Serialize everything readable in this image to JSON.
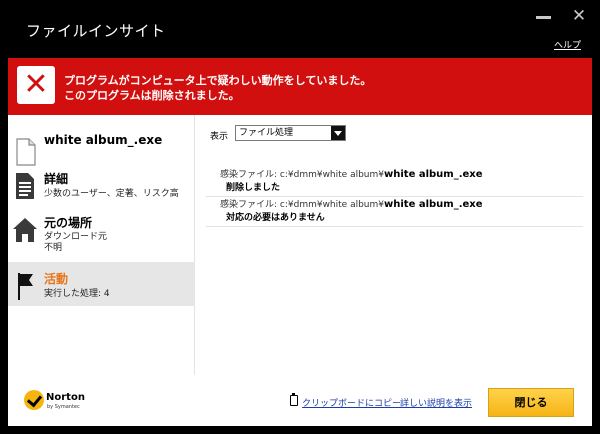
{
  "window": {
    "title": "ファイルインサイト",
    "help_label": "ヘルプ"
  },
  "alert": {
    "line1": "プログラムがコンピュータ上で疑わしい動作をしていました。",
    "line2": "このプログラムは削除されました。"
  },
  "sidebar": {
    "file_name": "white album_.exe",
    "details": {
      "title": "詳細",
      "subtitle": "少数のユーザー、定著、リスク高"
    },
    "origin": {
      "title": "元の場所",
      "sub1": "ダウンロード元",
      "sub2": "不明"
    },
    "activity": {
      "title": "活動",
      "subtitle": "実行した処理: 4"
    }
  },
  "panel": {
    "view_label": "表示",
    "view_selected": "ファイル処理",
    "rows": [
      {
        "prefix": "感染ファイル: c:¥dmm¥white album¥",
        "file": "white album_.exe",
        "status": "削除しました"
      },
      {
        "prefix": "感染ファイル: c:¥dmm¥white album¥",
        "file": "white album_.exe",
        "status": "対応の必要はありません"
      }
    ]
  },
  "footer": {
    "brand": "Norton",
    "brand_sub": "by Symantec",
    "clipboard_label": "クリップボードにコピー",
    "details_label": "詳しい説明を表示",
    "close_label": "閉じる"
  },
  "colors": {
    "alert_red": "#d20f0f",
    "active_orange": "#e8761c",
    "button_yellow": "#f6b416",
    "link_blue": "#1a3ea8"
  }
}
